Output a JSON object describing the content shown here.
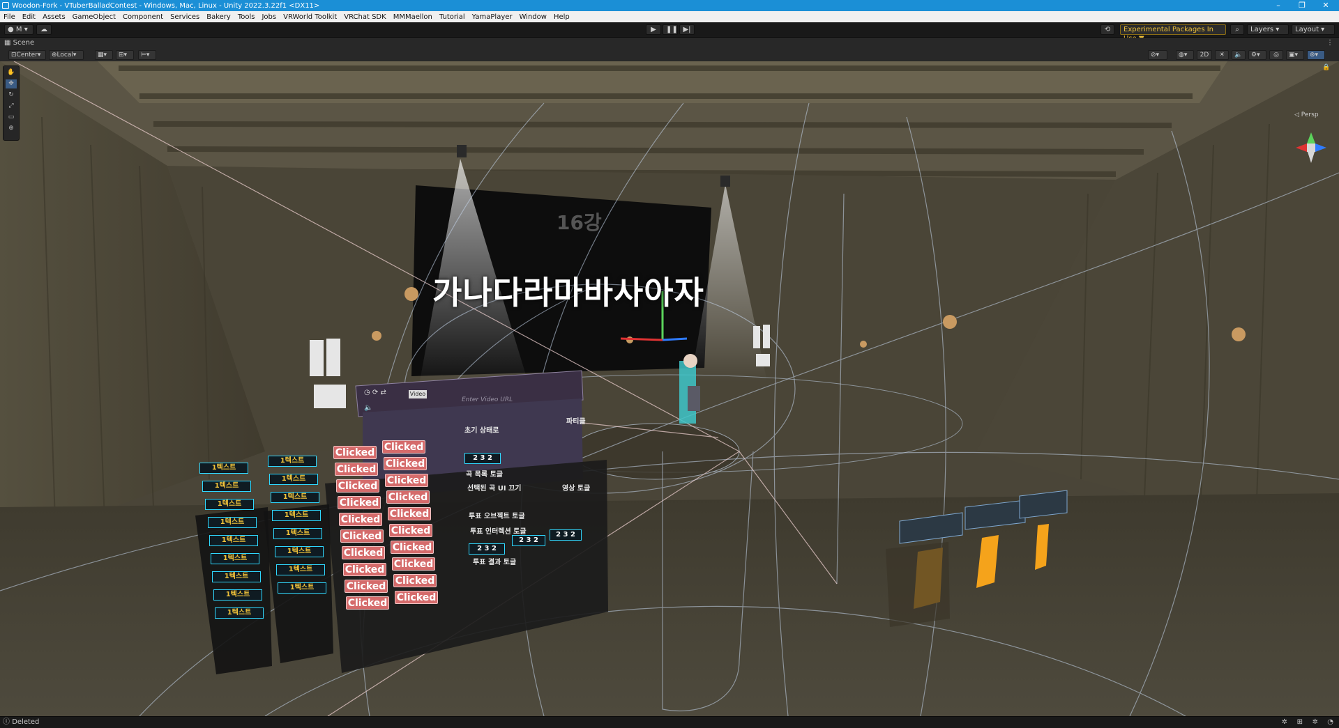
{
  "window": {
    "title": "Woodon-Fork - VTuberBalladContest - Windows, Mac, Linux - Unity 2022.3.22f1 <DX11>"
  },
  "menu": [
    "File",
    "Edit",
    "Assets",
    "GameObject",
    "Component",
    "Services",
    "Bakery",
    "Tools",
    "Jobs",
    "VRWorld Toolkit",
    "VRChat SDK",
    "MMMaellon",
    "Tutorial",
    "YamaPlayer",
    "Window",
    "Help"
  ],
  "toolbar": {
    "account_label": "M",
    "packages_label": "Experimental Packages In Use ▼",
    "layers_label": "Layers",
    "layout_label": "Layout"
  },
  "scene": {
    "tab_label": "Scene",
    "pivot_label": "Center",
    "space_label": "Local",
    "toggle_2d": "2D",
    "persp_label": "◁ Persp"
  },
  "viewport": {
    "big_text": "가나다라마바사아자",
    "screen_number": "16강",
    "video_label": "Video",
    "video_placeholder": "Enter Video URL",
    "panel_labels": [
      "초기 상태로",
      "파티클",
      "곡 목록 토글",
      "선택된 곡 UI 끄기",
      "영상 토글",
      "투표 오브젝트 토글",
      "투표 인터렉션 토글",
      "투표 결과 토글"
    ],
    "clicked_label": "Clicked",
    "select_label": "1텍스트",
    "num_labels": [
      "2",
      "3",
      "2"
    ]
  },
  "status": {
    "message": "Deleted"
  },
  "colors": {
    "titlebar": "#1b8fd6",
    "packages_accent": "#f0c23a",
    "clicked_button": "#d56b6b",
    "cyan_border": "#2fd8ff",
    "seat_orange": "#f5a31b"
  }
}
